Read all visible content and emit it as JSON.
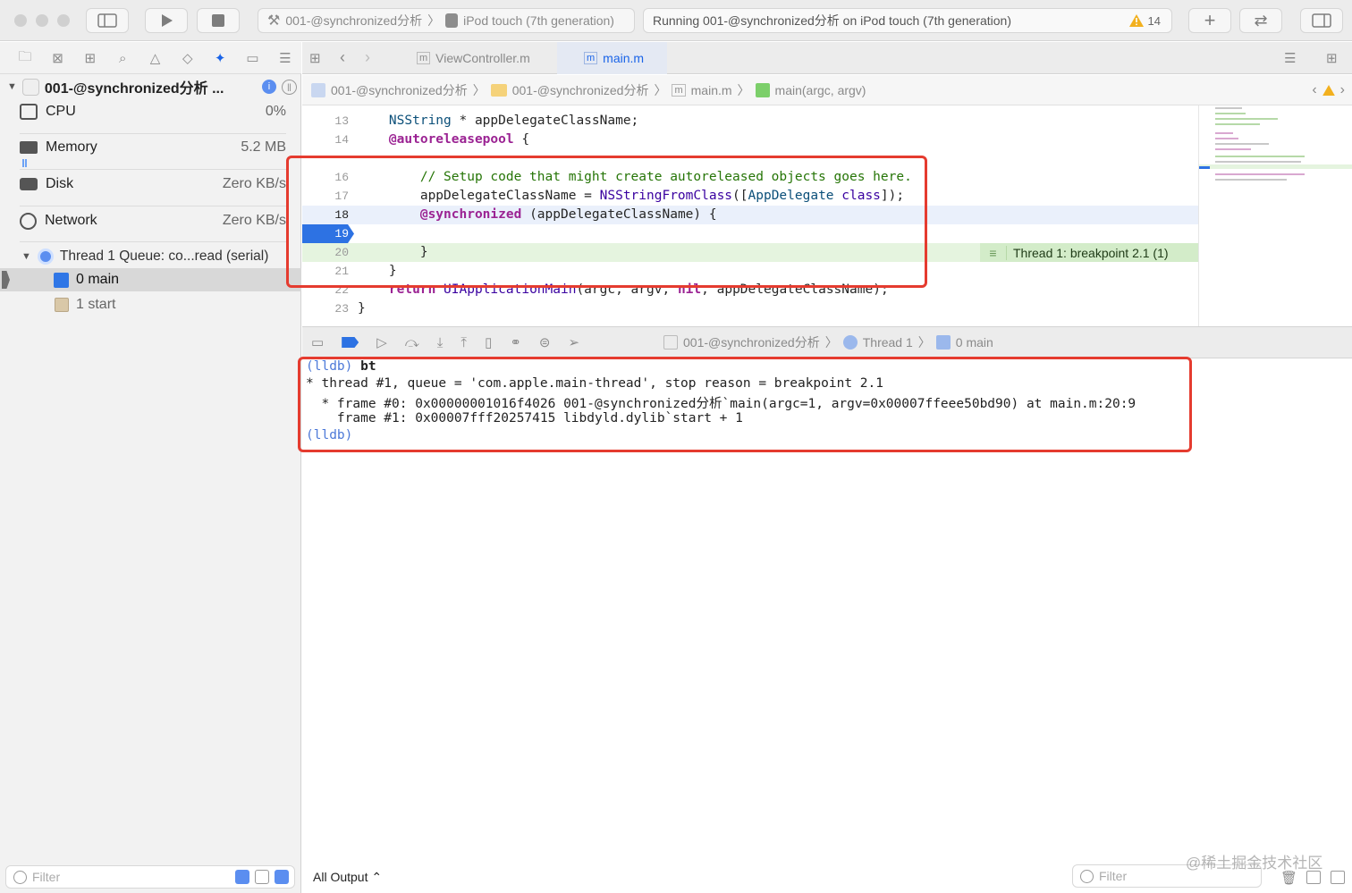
{
  "titlebar": {
    "scheme_target": "001-@synchronized分析",
    "device": "iPod touch (7th generation)",
    "activity_text": "Running 001-@synchronized分析 on iPod touch (7th generation)",
    "warning_count": "14"
  },
  "navigator": {
    "process_name": "001-@synchronized分析 ...",
    "gauges": [
      {
        "label": "CPU",
        "value": "0%"
      },
      {
        "label": "Memory",
        "value": "5.2 MB"
      },
      {
        "label": "Disk",
        "value": "Zero KB/s"
      },
      {
        "label": "Network",
        "value": "Zero KB/s"
      }
    ],
    "thread_label": "Thread 1 Queue: co...read (serial)",
    "frames": [
      "0 main",
      "1 start"
    ],
    "filter_placeholder": "Filter"
  },
  "editor": {
    "tabs": [
      "ViewController.m",
      "main.m"
    ],
    "breadcrumb": [
      "001-@synchronized分析",
      "001-@synchronized分析",
      "main.m",
      "main(argc, argv)"
    ],
    "lines": [
      {
        "n": "13",
        "text": "    NSString * appDelegateClassName;"
      },
      {
        "n": "14",
        "text": "    @autoreleasepool {"
      },
      {
        "n": "16",
        "text": "        // Setup code that might create autoreleased objects goes here."
      },
      {
        "n": "17",
        "text": "        appDelegateClassName = NSStringFromClass([AppDelegate class]);"
      },
      {
        "n": "18",
        "text": "        @synchronized (appDelegateClassName) {"
      },
      {
        "n": "19",
        "text": ""
      },
      {
        "n": "20",
        "text": "        }"
      },
      {
        "n": "21",
        "text": "    }"
      },
      {
        "n": "22",
        "text": "    return UIApplicationMain(argc, argv, nil, appDelegateClassName);"
      },
      {
        "n": "23",
        "text": "}"
      }
    ],
    "breakpoint_annotation": "Thread 1: breakpoint 2.1 (1)"
  },
  "debugbar": {
    "breadcrumb": [
      "001-@synchronized分析",
      "Thread 1",
      "0 main"
    ]
  },
  "console": {
    "lines": [
      {
        "prompt": "(lldb)",
        "text": " bt"
      },
      {
        "prompt": "",
        "text": "* thread #1, queue = 'com.apple.main-thread', stop reason = breakpoint 2.1"
      },
      {
        "prompt": "",
        "text": "  * frame #0: 0x00000001016f4026 001-@synchronized分析`main(argc=1, argv=0x00007ffeee50bd90) at main.m:20:9"
      },
      {
        "prompt": "",
        "text": "    frame #1: 0x00007fff20257415 libdyld.dylib`start + 1"
      },
      {
        "prompt": "(lldb)",
        "text": ""
      }
    ],
    "output_selector": "All Output ⌃",
    "filter_placeholder": "Filter"
  },
  "watermark": "@稀土掘金技术社区",
  "colors": {
    "accent": "#1a64e8",
    "highlight_red": "#e53b2f",
    "breakpoint_green": "#e5f4df"
  }
}
